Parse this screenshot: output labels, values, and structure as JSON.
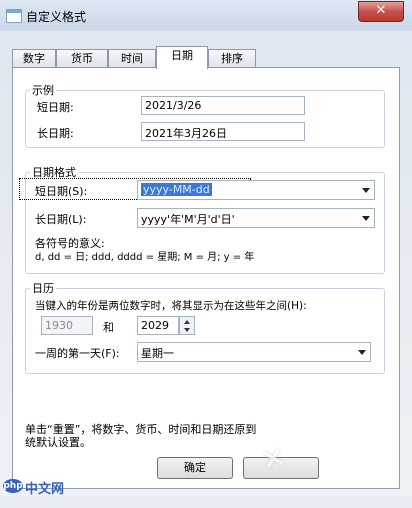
{
  "window": {
    "title": "自定义格式",
    "close_symbol": "✕"
  },
  "tabs": [
    {
      "label": "数字"
    },
    {
      "label": "货币"
    },
    {
      "label": "时间"
    },
    {
      "label": "日期"
    },
    {
      "label": "排序"
    }
  ],
  "active_tab": "日期",
  "example": {
    "title": "示例",
    "short_label": "短日期:",
    "short_value": "2021/3/26",
    "long_label": "长日期:",
    "long_value": "2021年3月26日"
  },
  "date_format": {
    "title": "日期格式",
    "short_label": "短日期(S):",
    "short_value": "yyyy-MM-dd",
    "long_label": "长日期(L):",
    "long_value": "yyyy'年'M'月'd'日'",
    "legend_title": "各符号的意义:",
    "legend_text": "d, dd = 日;  ddd, dddd = 星期;  M = 月;  y = 年"
  },
  "calendar": {
    "title": "日历",
    "desc": "当键入的年份是两位数字时，将其显示为在这些年之间(H):",
    "year_from": "1930",
    "and_label": "和",
    "year_to": "2029",
    "first_day_label": "一周的第一天(F):",
    "first_day_value": "星期一"
  },
  "reset_note_line1": "单击“重置”，将数字、货币、时间和日期还原到",
  "reset_note_line2": "统默认设置。",
  "buttons": {
    "ok": "确定"
  },
  "watermark": {
    "logo": "php",
    "site": "中文网",
    "overlay": "✕"
  }
}
